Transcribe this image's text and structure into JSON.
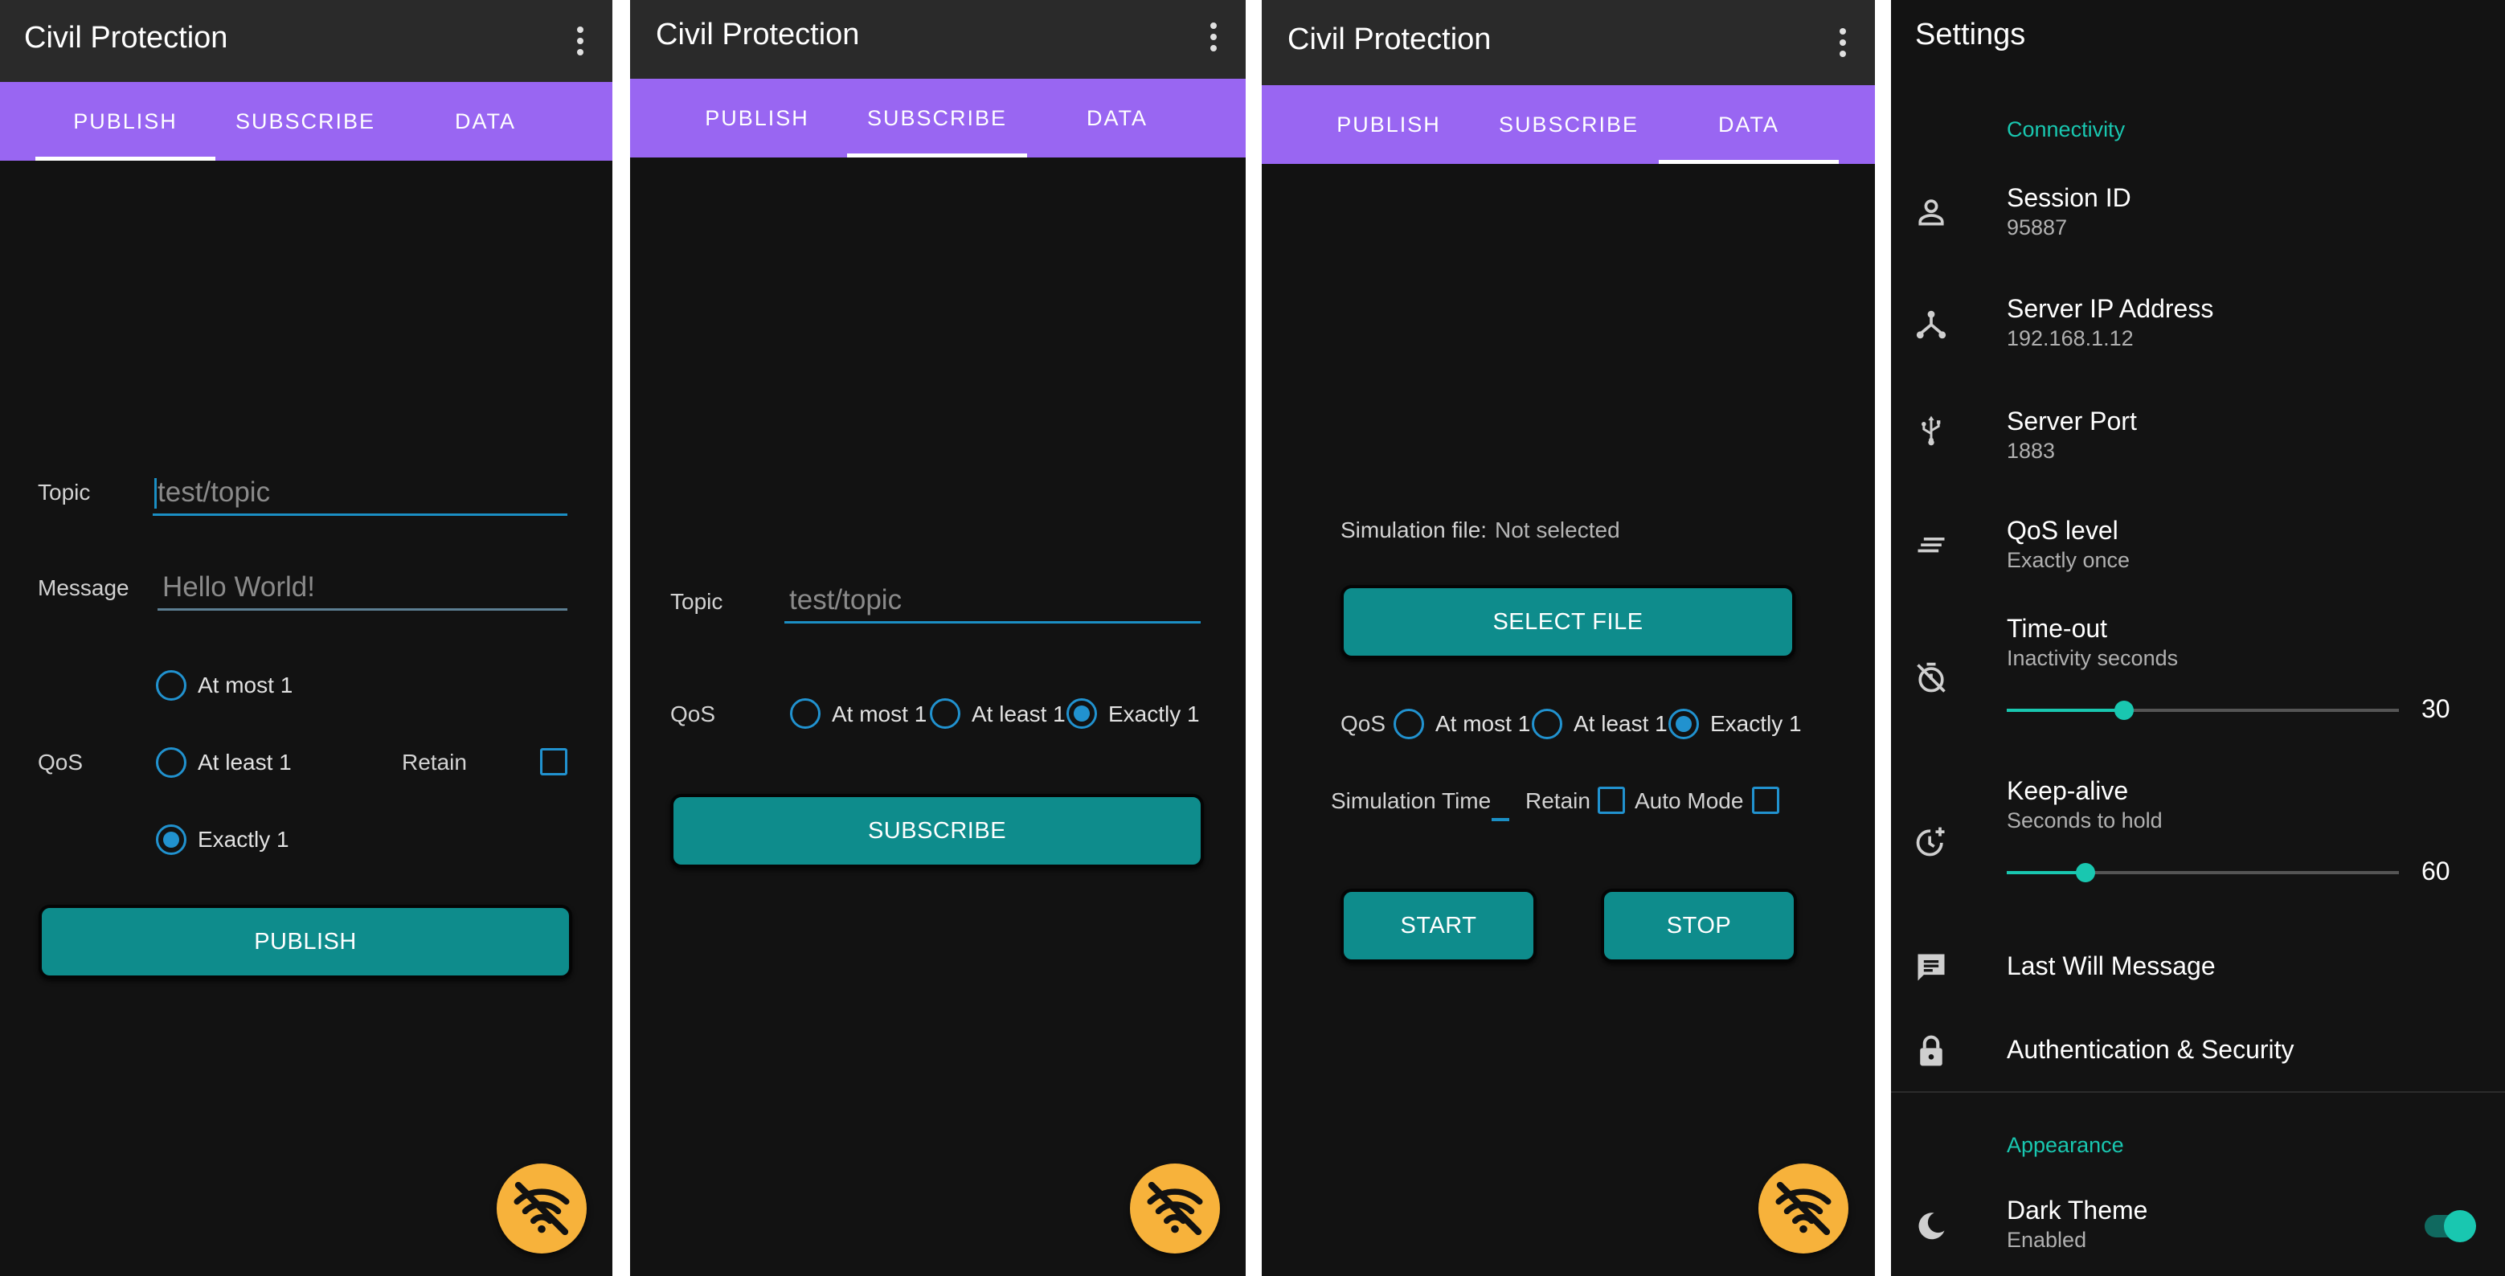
{
  "app": {
    "title": "Civil Protection",
    "tabs": [
      "PUBLISH",
      "SUBSCRIBE",
      "DATA"
    ]
  },
  "publish": {
    "topic_label": "Topic",
    "topic_placeholder": "test/topic",
    "message_label": "Message",
    "message_placeholder": "Hello World!",
    "qos_label": "QoS",
    "qos_options": [
      "At most 1",
      "At least 1",
      "Exactly 1"
    ],
    "qos_selected": "Exactly 1",
    "retain_label": "Retain",
    "retain_checked": false,
    "button": "PUBLISH"
  },
  "subscribe": {
    "topic_label": "Topic",
    "topic_placeholder": "test/topic",
    "qos_label": "QoS",
    "qos_options": [
      "At most 1",
      "At least 1",
      "Exactly 1"
    ],
    "qos_selected": "Exactly 1",
    "button": "SUBSCRIBE"
  },
  "data": {
    "sim_file_label": "Simulation file:",
    "sim_file_value": "Not selected",
    "select_button": "SELECT FILE",
    "qos_label": "QoS",
    "qos_options": [
      "At most 1",
      "At least 1",
      "Exactly 1"
    ],
    "qos_selected": "Exactly 1",
    "sim_time_label": "Simulation Time",
    "retain_label": "Retain",
    "auto_mode_label": "Auto Mode",
    "start_button": "START",
    "stop_button": "STOP"
  },
  "fab": {
    "icon": "wifi-off-icon",
    "color": "#f7b23b"
  },
  "settings": {
    "title": "Settings",
    "connectivity_header": "Connectivity",
    "session_id": {
      "title": "Session ID",
      "value": "95887",
      "icon": "person-icon"
    },
    "server_ip": {
      "title": "Server IP Address",
      "value": "192.168.1.12",
      "icon": "network-icon"
    },
    "server_port": {
      "title": "Server Port",
      "value": "1883",
      "icon": "usb-icon"
    },
    "qos_level": {
      "title": "QoS level",
      "value": "Exactly once",
      "icon": "lines-icon"
    },
    "timeout": {
      "title": "Time-out",
      "subtitle": "Inactivity seconds",
      "value": "30",
      "fraction": 0.3,
      "icon": "timer-off-icon"
    },
    "keepalive": {
      "title": "Keep-alive",
      "subtitle": "Seconds to hold",
      "value": "60",
      "fraction": 0.2,
      "icon": "clock-plus-icon"
    },
    "last_will": {
      "title": "Last Will Message",
      "icon": "message-icon"
    },
    "auth": {
      "title": "Authentication & Security",
      "icon": "lock-icon"
    },
    "appearance_header": "Appearance",
    "dark_theme": {
      "title": "Dark Theme",
      "value": "Enabled",
      "enabled": true,
      "icon": "moon-icon"
    }
  },
  "colors": {
    "accent_purple": "#9966f2",
    "button_teal": "#0e8c8c",
    "radio_blue": "#2192cf",
    "settings_teal": "#19c7b0",
    "fab_orange": "#f7b23b"
  }
}
